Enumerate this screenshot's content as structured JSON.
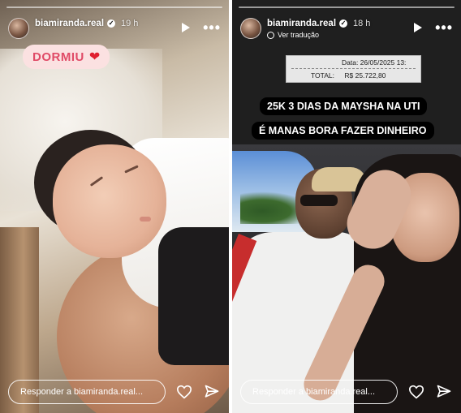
{
  "stories": [
    {
      "username": "biamiranda.real",
      "verified": true,
      "time_ago": "19 h",
      "sticker": {
        "text": "DORMIU",
        "emoji": "❤️"
      },
      "reply_placeholder": "Responder a biamiranda.real...",
      "icons": [
        "play-icon",
        "more-icon",
        "heart-icon",
        "send-icon",
        "verified-badge-icon"
      ]
    },
    {
      "username": "biamiranda.real",
      "verified": true,
      "time_ago": "18 h",
      "translate_label": "Ver tradução",
      "receipt": {
        "data_label": "Data:",
        "data_value": "26/05/2025 13:",
        "total_label": "TOTAL:",
        "total_value": "R$ 25.722,80"
      },
      "captions": [
        "25K 3 DIAS DA MAYSHA NA UTI",
        "É MANAS BORA FAZER DINHEIRO"
      ],
      "reply_placeholder": "Responder a biamiranda.real...",
      "icons": [
        "play-icon",
        "more-icon",
        "heart-icon",
        "send-icon",
        "globe-icon"
      ]
    }
  ],
  "colors": {
    "sticker_bg": "#fbe1e1",
    "sticker_text": "#e04a66",
    "caption_bg": "#000000"
  }
}
